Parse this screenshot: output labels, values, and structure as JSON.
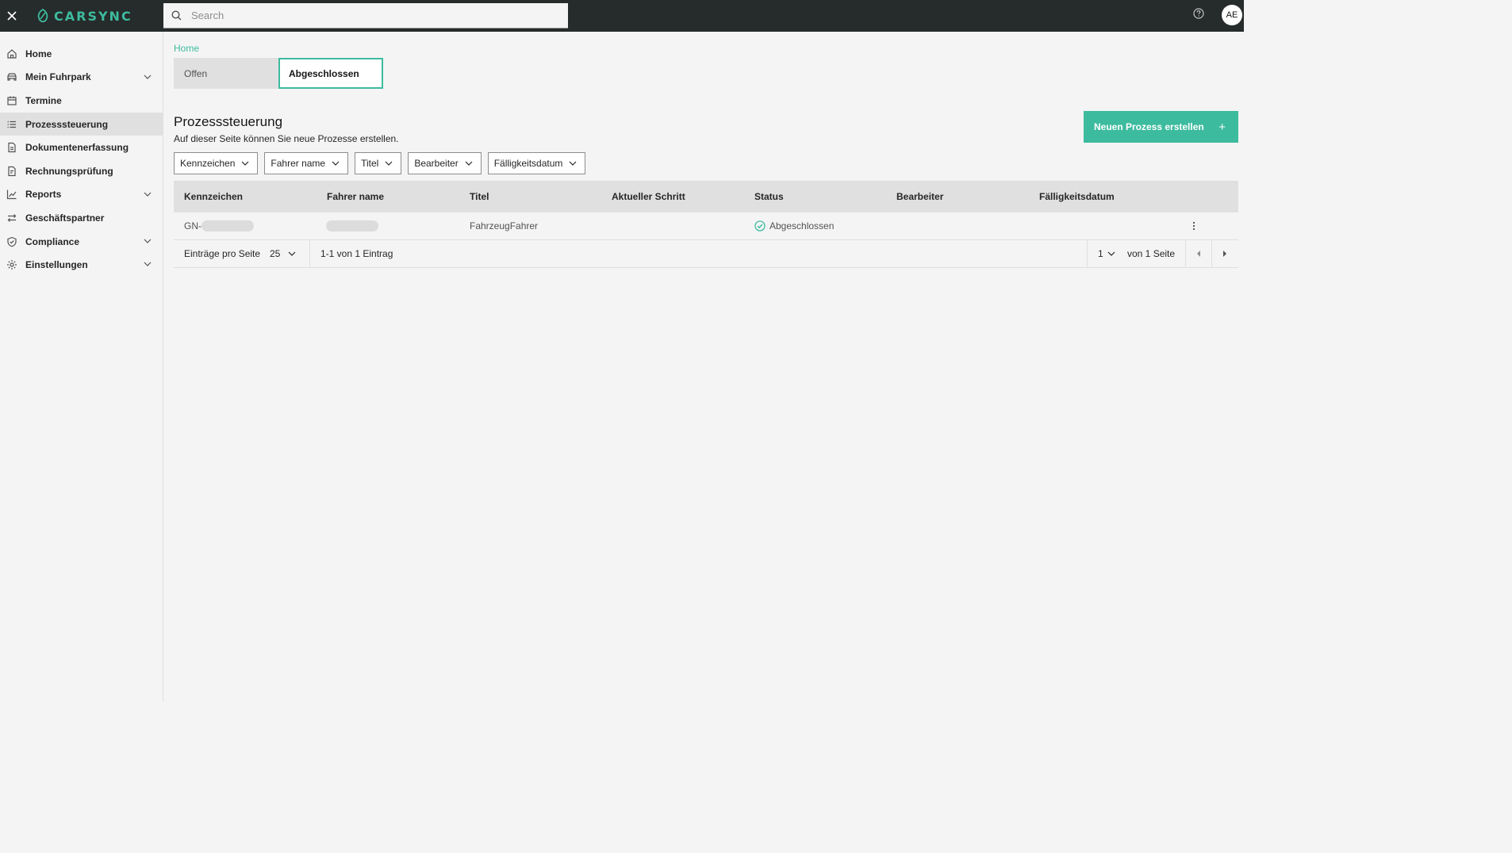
{
  "header": {
    "logo_text": "CARSYNC",
    "search_placeholder": "Search",
    "avatar_initials": "AE"
  },
  "sidebar": {
    "items": [
      {
        "label": "Home",
        "icon": "home-icon"
      },
      {
        "label": "Mein Fuhrpark",
        "icon": "car-icon",
        "expandable": true
      },
      {
        "label": "Termine",
        "icon": "calendar-icon"
      },
      {
        "label": "Prozesssteuerung",
        "icon": "list-icon",
        "active": true
      },
      {
        "label": "Dokumentenerfassung",
        "icon": "document-icon"
      },
      {
        "label": "Rechnungsprüfung",
        "icon": "invoice-icon"
      },
      {
        "label": "Reports",
        "icon": "chart-icon",
        "expandable": true
      },
      {
        "label": "Geschäftspartner",
        "icon": "exchange-icon"
      },
      {
        "label": "Compliance",
        "icon": "shield-icon",
        "expandable": true
      },
      {
        "label": "Einstellungen",
        "icon": "settings-icon",
        "expandable": true
      }
    ]
  },
  "main": {
    "breadcrumb": "Home",
    "tabs": [
      {
        "label": "Offen",
        "selected": false
      },
      {
        "label": "Abgeschlossen",
        "selected": true
      }
    ],
    "title": "Prozesssteuerung",
    "description": "Auf dieser Seite können Sie neue Prozesse erstellen.",
    "create_button": "Neuen Prozess erstellen",
    "create_button_icon": "+",
    "filters": [
      "Kennzeichen",
      "Fahrer name",
      "Titel",
      "Bearbeiter",
      "Fälligkeitsdatum"
    ],
    "table": {
      "columns": [
        "Kennzeichen",
        "Fahrer name",
        "Titel",
        "Aktueller Schritt",
        "Status",
        "Bearbeiter",
        "Fälligkeitsdatum"
      ],
      "rows": [
        {
          "kennzeichen": "GN-",
          "fahrer": "",
          "titel": "FahrzeugFahrer",
          "schritt": "",
          "status": "Abgeschlossen",
          "bearbeiter": "",
          "faelligkeit": ""
        }
      ]
    },
    "pagination": {
      "per_page_label": "Einträge pro Seite",
      "per_page_value": "25",
      "range_text": "1-1 von 1 Eintrag",
      "current_page": "1",
      "total_pages_text": "von 1 Seite"
    }
  },
  "colors": {
    "accent": "#3dbb9e",
    "topbar": "#262b2b"
  }
}
